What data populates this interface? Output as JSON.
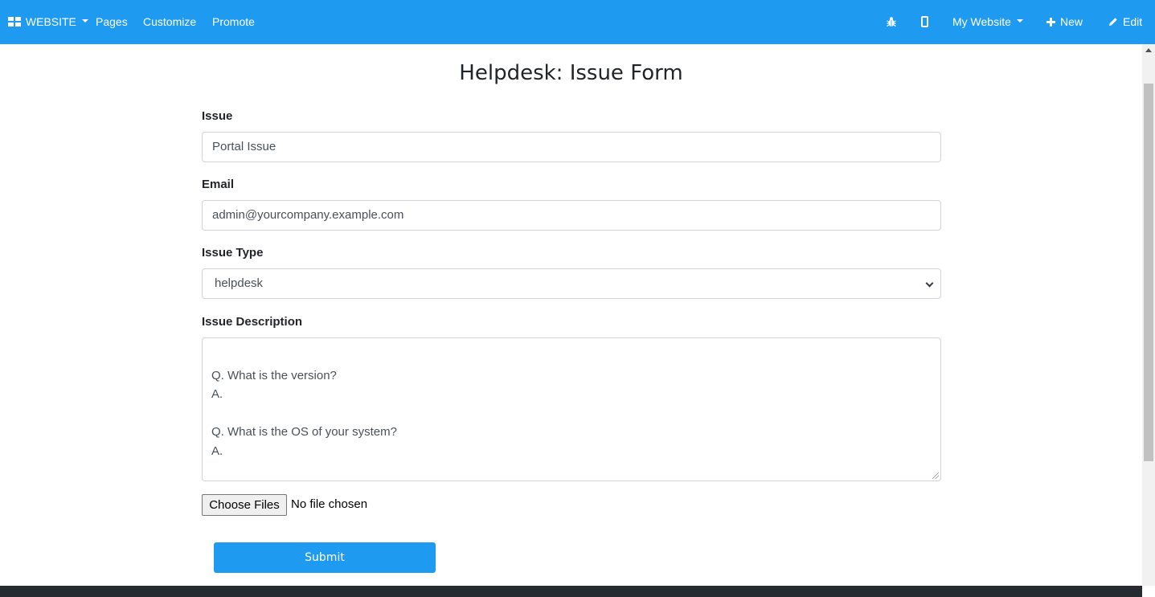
{
  "navbar": {
    "brand": "WEBSITE",
    "menu": [
      "Pages",
      "Customize",
      "Promote"
    ],
    "right": {
      "site_label": "My Website",
      "new_label": "New",
      "edit_label": "Edit"
    },
    "bg_color": "#1e9bf0"
  },
  "form": {
    "title": "Helpdesk: Issue Form",
    "issue_label": "Issue",
    "issue_value": "Portal Issue",
    "email_label": "Email",
    "email_value": "admin@yourcompany.example.com",
    "type_label": "Issue Type",
    "type_value": "helpdesk",
    "desc_label": "Issue Description",
    "desc_lines": [
      "",
      "Q. What is the version?",
      "A.",
      "",
      "Q. What is the OS of your system?",
      "A."
    ],
    "file_button": "Choose Files",
    "file_status": "No file chosen",
    "submit_label": "Submit"
  }
}
